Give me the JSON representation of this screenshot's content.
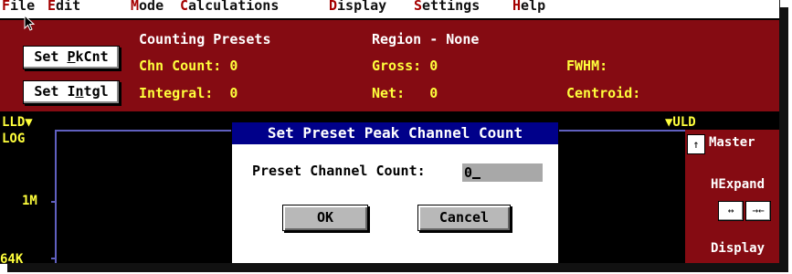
{
  "menu": {
    "items": [
      {
        "hotkey": "F",
        "rest": "ile"
      },
      {
        "hotkey": "E",
        "rest": "dit"
      },
      {
        "hotkey": "M",
        "rest": "ode"
      },
      {
        "hotkey": "C",
        "rest": "alculations"
      },
      {
        "hotkey": "D",
        "rest": "isplay"
      },
      {
        "hotkey": "S",
        "rest": "ettings"
      },
      {
        "hotkey": "H",
        "rest": "elp"
      }
    ]
  },
  "panel": {
    "buttons": {
      "pkcnt": {
        "pre": "Set ",
        "hotkey": "P",
        "post": "kCnt"
      },
      "intgl": {
        "pre": "Set I",
        "hotkey": "n",
        "post": "tgl"
      }
    },
    "counting_presets": "Counting Presets",
    "chn_count": "Chn Count: 0",
    "integral": "Integral:  0",
    "region": "Region - None",
    "gross": "Gross: 0",
    "net": "Net:   0",
    "fwhm": "FWHM:",
    "centroid": "Centroid:"
  },
  "spectrum": {
    "lld": "LLD▼",
    "uld": "▼ULD",
    "log": "LOG",
    "y_1m": "1M",
    "y_64k": "64K",
    "master": "Master",
    "hexpand": "HExpand",
    "display": "Display",
    "scroll_up": "↑",
    "expand": "↔",
    "contract": "→←"
  },
  "dialog": {
    "title": "Set Preset Peak Channel Count",
    "label": "Preset Channel Count:",
    "value": "0",
    "ok": "OK",
    "cancel": "Cancel"
  },
  "colors": {
    "panel_bg": "#850b12",
    "title_bar": "#00008a",
    "value_text": "#ffff3c",
    "menu_hotkey": "#a40000"
  }
}
